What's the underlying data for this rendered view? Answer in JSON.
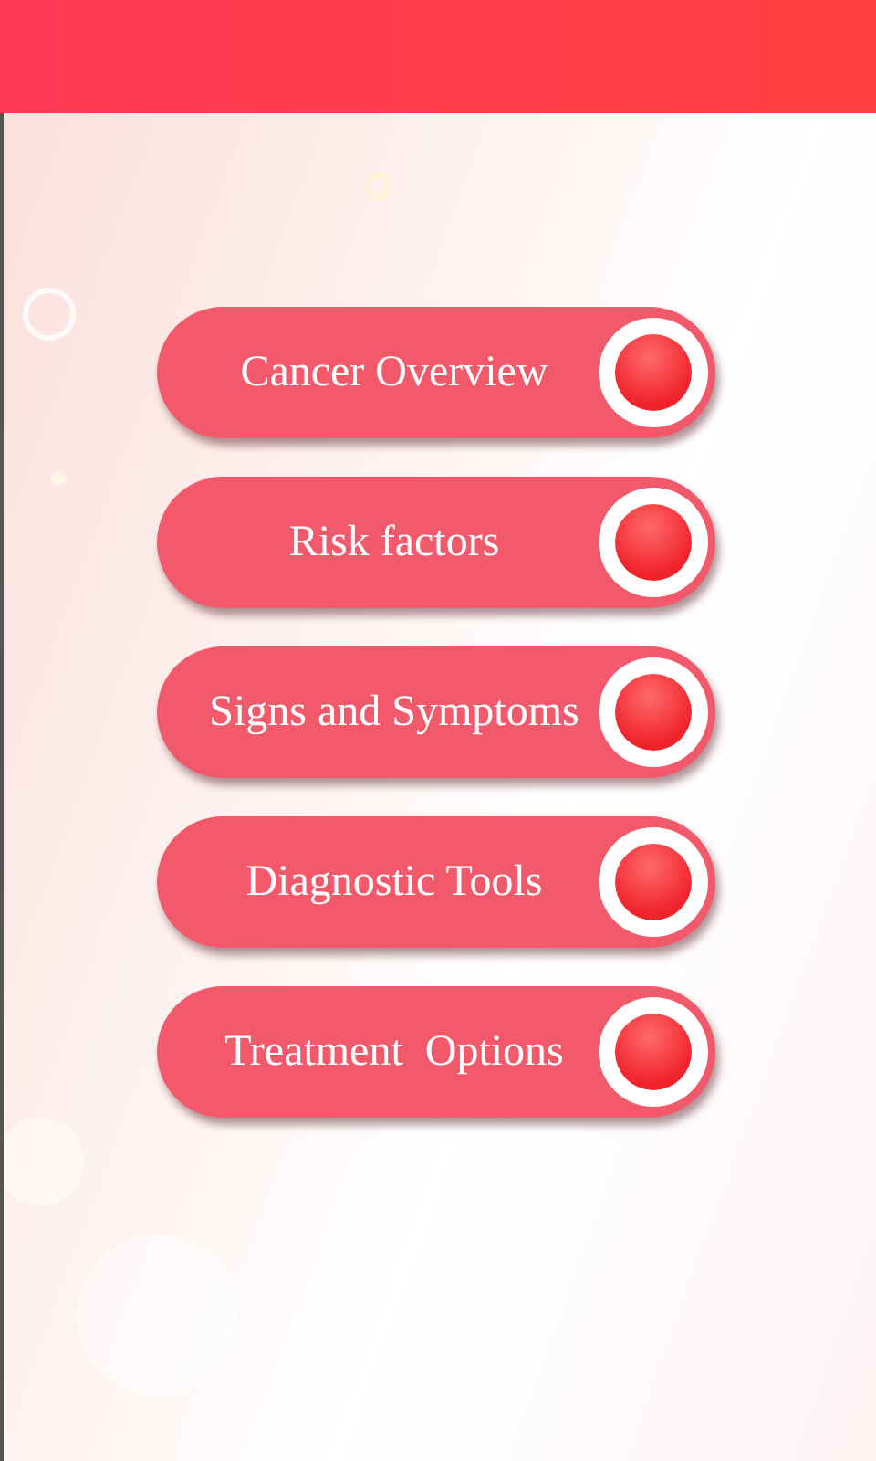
{
  "menu": [
    {
      "label": "Cancer Overview"
    },
    {
      "label": "Risk factors"
    },
    {
      "label": "Signs and Symptoms"
    },
    {
      "label": "Diagnostic Tools"
    },
    {
      "label": "Treatment  Options"
    }
  ]
}
